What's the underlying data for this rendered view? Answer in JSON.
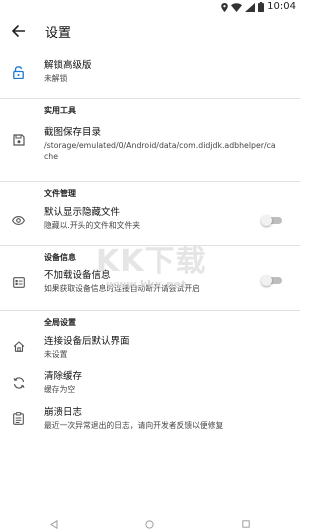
{
  "status_bar": {
    "time": "10:04",
    "icons": [
      "location-icon",
      "wifi-icon",
      "signal-icon",
      "battery-icon"
    ]
  },
  "app_bar": {
    "title": "设置",
    "back_icon": "arrow-back-icon"
  },
  "unlock": {
    "title": "解锁高级版",
    "subtitle": "未解锁",
    "icon": "lock-open-icon"
  },
  "sections": {
    "tools": "实用工具",
    "files": "文件管理",
    "device": "设备信息",
    "global": "全局设置"
  },
  "screenshot_dir": {
    "title": "截图保存目录",
    "subtitle": "/storage/emulated/0/Android/data/com.didjdk.adbhelper/cache",
    "icon": "save-icon"
  },
  "show_hidden": {
    "title": "默认显示隐藏文件",
    "subtitle": "隐藏以.开头的文件和文件夹",
    "icon": "eye-icon",
    "enabled": false
  },
  "no_device_info": {
    "title": "不加载设备信息",
    "subtitle": "如果获取设备信息时连接自动断开请尝试开启",
    "icon": "device-info-icon",
    "enabled": false
  },
  "default_screen": {
    "title": "连接设备后默认界面",
    "subtitle": "未设置",
    "icon": "home-icon"
  },
  "clear_cache": {
    "title": "清除缓存",
    "subtitle": "缓存为空",
    "icon": "refresh-icon"
  },
  "crash_log": {
    "title": "崩溃日志",
    "subtitle": "最近一次异常退出的日志，请向开发者反馈以便修复",
    "icon": "clipboard-icon"
  },
  "watermark": {
    "logo": "KK下载",
    "url": "www.kkx.net"
  },
  "colors": {
    "accent": "#1976d2",
    "divider": "#e0e0e0",
    "switch_track": "#bdbdbd",
    "switch_thumb": "#f1f1f1"
  }
}
